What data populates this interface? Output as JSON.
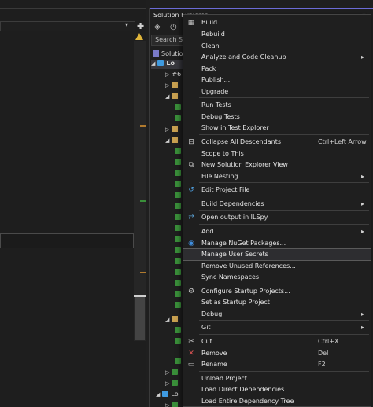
{
  "solution_explorer": {
    "title": "Solution Explorer",
    "search_placeholder": "Search Solu",
    "tree": [
      "Solution",
      "Lo",
      "#6",
      "Lo"
    ]
  },
  "context_menu": {
    "items": [
      {
        "label": "Build",
        "icon": "build-icon"
      },
      {
        "label": "Rebuild"
      },
      {
        "label": "Clean"
      },
      {
        "label": "Analyze and Code Cleanup",
        "submenu": true
      },
      {
        "label": "Pack"
      },
      {
        "label": "Publish..."
      },
      {
        "label": "Upgrade"
      },
      {
        "label": "Run Tests"
      },
      {
        "label": "Debug Tests"
      },
      {
        "label": "Show in Test Explorer"
      },
      {
        "label": "Collapse All Descendants",
        "shortcut": "Ctrl+Left Arrow",
        "icon": "collapse-icon"
      },
      {
        "label": "Scope to This"
      },
      {
        "label": "New Solution Explorer View",
        "icon": "new-view-icon"
      },
      {
        "label": "File Nesting",
        "submenu": true
      },
      {
        "label": "Edit Project File",
        "icon": "edit-project-icon"
      },
      {
        "label": "Build Dependencies",
        "submenu": true
      },
      {
        "label": "Open output in ILSpy",
        "icon": "ilspy-icon"
      },
      {
        "label": "Add",
        "submenu": true
      },
      {
        "label": "Manage NuGet Packages...",
        "icon": "nuget-icon"
      },
      {
        "label": "Manage User Secrets"
      },
      {
        "label": "Remove Unused References..."
      },
      {
        "label": "Sync Namespaces"
      },
      {
        "label": "Configure Startup Projects...",
        "icon": "gear-icon"
      },
      {
        "label": "Set as Startup Project"
      },
      {
        "label": "Debug",
        "submenu": true
      },
      {
        "label": "Git",
        "submenu": true
      },
      {
        "label": "Cut",
        "shortcut": "Ctrl+X",
        "icon": "cut-icon"
      },
      {
        "label": "Remove",
        "shortcut": "Del",
        "icon": "remove-icon"
      },
      {
        "label": "Rename",
        "shortcut": "F2",
        "icon": "rename-icon"
      },
      {
        "label": "Unload Project"
      },
      {
        "label": "Load Direct Dependencies"
      },
      {
        "label": "Load Entire Dependency Tree"
      }
    ]
  },
  "colors": {
    "accent": "#6b6bd6",
    "highlight": "#2d2d30",
    "warning": "#e0b53a",
    "remove_icon": "#e05555",
    "nuget_icon": "#3f8fe0"
  }
}
